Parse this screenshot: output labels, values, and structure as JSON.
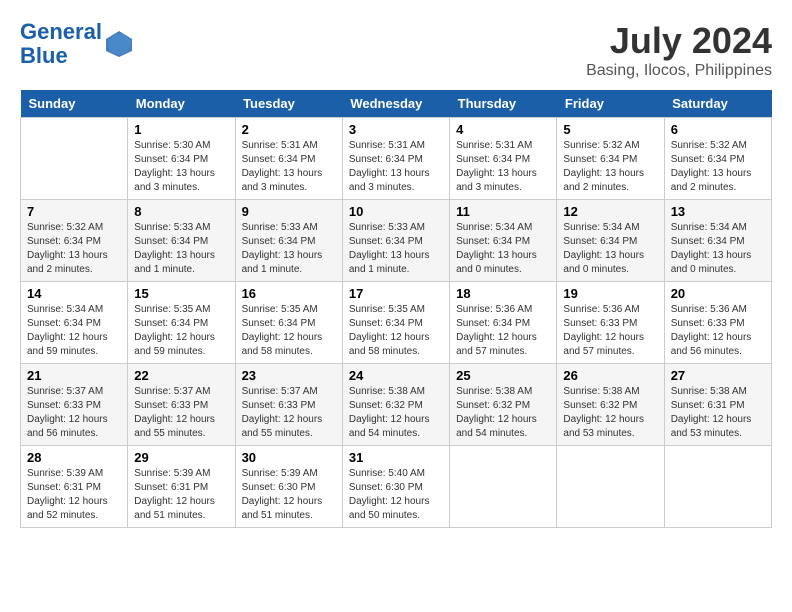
{
  "header": {
    "logo_line1": "General",
    "logo_line2": "Blue",
    "month_year": "July 2024",
    "location": "Basing, Ilocos, Philippines"
  },
  "days_of_week": [
    "Sunday",
    "Monday",
    "Tuesday",
    "Wednesday",
    "Thursday",
    "Friday",
    "Saturday"
  ],
  "weeks": [
    [
      {
        "day": "",
        "info": ""
      },
      {
        "day": "1",
        "info": "Sunrise: 5:30 AM\nSunset: 6:34 PM\nDaylight: 13 hours\nand 3 minutes."
      },
      {
        "day": "2",
        "info": "Sunrise: 5:31 AM\nSunset: 6:34 PM\nDaylight: 13 hours\nand 3 minutes."
      },
      {
        "day": "3",
        "info": "Sunrise: 5:31 AM\nSunset: 6:34 PM\nDaylight: 13 hours\nand 3 minutes."
      },
      {
        "day": "4",
        "info": "Sunrise: 5:31 AM\nSunset: 6:34 PM\nDaylight: 13 hours\nand 3 minutes."
      },
      {
        "day": "5",
        "info": "Sunrise: 5:32 AM\nSunset: 6:34 PM\nDaylight: 13 hours\nand 2 minutes."
      },
      {
        "day": "6",
        "info": "Sunrise: 5:32 AM\nSunset: 6:34 PM\nDaylight: 13 hours\nand 2 minutes."
      }
    ],
    [
      {
        "day": "7",
        "info": "Sunrise: 5:32 AM\nSunset: 6:34 PM\nDaylight: 13 hours\nand 2 minutes."
      },
      {
        "day": "8",
        "info": "Sunrise: 5:33 AM\nSunset: 6:34 PM\nDaylight: 13 hours\nand 1 minute."
      },
      {
        "day": "9",
        "info": "Sunrise: 5:33 AM\nSunset: 6:34 PM\nDaylight: 13 hours\nand 1 minute."
      },
      {
        "day": "10",
        "info": "Sunrise: 5:33 AM\nSunset: 6:34 PM\nDaylight: 13 hours\nand 1 minute."
      },
      {
        "day": "11",
        "info": "Sunrise: 5:34 AM\nSunset: 6:34 PM\nDaylight: 13 hours\nand 0 minutes."
      },
      {
        "day": "12",
        "info": "Sunrise: 5:34 AM\nSunset: 6:34 PM\nDaylight: 13 hours\nand 0 minutes."
      },
      {
        "day": "13",
        "info": "Sunrise: 5:34 AM\nSunset: 6:34 PM\nDaylight: 13 hours\nand 0 minutes."
      }
    ],
    [
      {
        "day": "14",
        "info": "Sunrise: 5:34 AM\nSunset: 6:34 PM\nDaylight: 12 hours\nand 59 minutes."
      },
      {
        "day": "15",
        "info": "Sunrise: 5:35 AM\nSunset: 6:34 PM\nDaylight: 12 hours\nand 59 minutes."
      },
      {
        "day": "16",
        "info": "Sunrise: 5:35 AM\nSunset: 6:34 PM\nDaylight: 12 hours\nand 58 minutes."
      },
      {
        "day": "17",
        "info": "Sunrise: 5:35 AM\nSunset: 6:34 PM\nDaylight: 12 hours\nand 58 minutes."
      },
      {
        "day": "18",
        "info": "Sunrise: 5:36 AM\nSunset: 6:34 PM\nDaylight: 12 hours\nand 57 minutes."
      },
      {
        "day": "19",
        "info": "Sunrise: 5:36 AM\nSunset: 6:33 PM\nDaylight: 12 hours\nand 57 minutes."
      },
      {
        "day": "20",
        "info": "Sunrise: 5:36 AM\nSunset: 6:33 PM\nDaylight: 12 hours\nand 56 minutes."
      }
    ],
    [
      {
        "day": "21",
        "info": "Sunrise: 5:37 AM\nSunset: 6:33 PM\nDaylight: 12 hours\nand 56 minutes."
      },
      {
        "day": "22",
        "info": "Sunrise: 5:37 AM\nSunset: 6:33 PM\nDaylight: 12 hours\nand 55 minutes."
      },
      {
        "day": "23",
        "info": "Sunrise: 5:37 AM\nSunset: 6:33 PM\nDaylight: 12 hours\nand 55 minutes."
      },
      {
        "day": "24",
        "info": "Sunrise: 5:38 AM\nSunset: 6:32 PM\nDaylight: 12 hours\nand 54 minutes."
      },
      {
        "day": "25",
        "info": "Sunrise: 5:38 AM\nSunset: 6:32 PM\nDaylight: 12 hours\nand 54 minutes."
      },
      {
        "day": "26",
        "info": "Sunrise: 5:38 AM\nSunset: 6:32 PM\nDaylight: 12 hours\nand 53 minutes."
      },
      {
        "day": "27",
        "info": "Sunrise: 5:38 AM\nSunset: 6:31 PM\nDaylight: 12 hours\nand 53 minutes."
      }
    ],
    [
      {
        "day": "28",
        "info": "Sunrise: 5:39 AM\nSunset: 6:31 PM\nDaylight: 12 hours\nand 52 minutes."
      },
      {
        "day": "29",
        "info": "Sunrise: 5:39 AM\nSunset: 6:31 PM\nDaylight: 12 hours\nand 51 minutes."
      },
      {
        "day": "30",
        "info": "Sunrise: 5:39 AM\nSunset: 6:30 PM\nDaylight: 12 hours\nand 51 minutes."
      },
      {
        "day": "31",
        "info": "Sunrise: 5:40 AM\nSunset: 6:30 PM\nDaylight: 12 hours\nand 50 minutes."
      },
      {
        "day": "",
        "info": ""
      },
      {
        "day": "",
        "info": ""
      },
      {
        "day": "",
        "info": ""
      }
    ]
  ]
}
